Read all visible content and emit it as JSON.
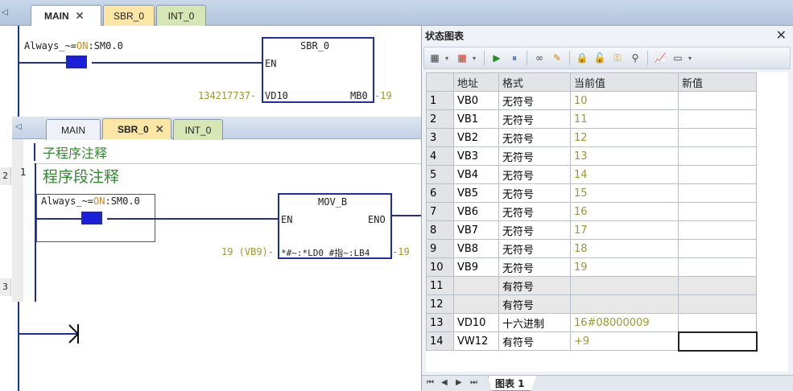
{
  "back_tabs": [
    {
      "label": "MAIN",
      "close": "✕"
    },
    {
      "label": "SBR_0"
    },
    {
      "label": "INT_0"
    }
  ],
  "back_rungs": [
    "2",
    "3"
  ],
  "main_network": {
    "contact_label": "Always_~=",
    "contact_state": "ON",
    "contact_addr": ":SM0.0",
    "block_title": "SBR_0",
    "block_en": "EN",
    "param_in_value": "134217737",
    "param_in": "VD10",
    "param_out": "MB0",
    "param_out_value": "19"
  },
  "front_tabs": [
    {
      "label": "MAIN"
    },
    {
      "label": "SBR_0",
      "close": "✕"
    },
    {
      "label": "INT_0"
    }
  ],
  "sbr": {
    "subroutine_comment": "子程序注释",
    "network_number": "1",
    "network_comment": "程序段注释",
    "contact_label": "Always_~=",
    "contact_state": "ON",
    "contact_addr": ":SM0.0",
    "block_title": "MOV_B",
    "block_en": "EN",
    "block_eno": "ENO",
    "in_value": "19 (VB9)",
    "out_param": "*#~:*LD0 #指~:LB4",
    "out_value": "19"
  },
  "panel": {
    "title": "状态图表",
    "close": "✕",
    "toolbar_icons": [
      "add-row-icon",
      "delete-row-icon",
      "play-icon",
      "pause-icon",
      "glasses-icon",
      "pencil-icon",
      "lock-icon",
      "unlock-icon",
      "force-icon",
      "read-all-icon",
      "trend-chart-icon",
      "label-icon"
    ],
    "columns": [
      "",
      "地址",
      "格式",
      "当前值",
      "新值"
    ],
    "rows": [
      {
        "n": "1",
        "addr": "VB0",
        "fmt": "无符号",
        "val": "10",
        "new": ""
      },
      {
        "n": "2",
        "addr": "VB1",
        "fmt": "无符号",
        "val": "11",
        "new": ""
      },
      {
        "n": "3",
        "addr": "VB2",
        "fmt": "无符号",
        "val": "12",
        "new": ""
      },
      {
        "n": "4",
        "addr": "VB3",
        "fmt": "无符号",
        "val": "13",
        "new": ""
      },
      {
        "n": "5",
        "addr": "VB4",
        "fmt": "无符号",
        "val": "14",
        "new": ""
      },
      {
        "n": "6",
        "addr": "VB5",
        "fmt": "无符号",
        "val": "15",
        "new": ""
      },
      {
        "n": "7",
        "addr": "VB6",
        "fmt": "无符号",
        "val": "16",
        "new": ""
      },
      {
        "n": "8",
        "addr": "VB7",
        "fmt": "无符号",
        "val": "17",
        "new": ""
      },
      {
        "n": "9",
        "addr": "VB8",
        "fmt": "无符号",
        "val": "18",
        "new": ""
      },
      {
        "n": "10",
        "addr": "VB9",
        "fmt": "无符号",
        "val": "19",
        "new": ""
      },
      {
        "n": "11",
        "addr": "",
        "fmt": "有符号",
        "val": "",
        "new": ""
      },
      {
        "n": "12",
        "addr": "",
        "fmt": "有符号",
        "val": "",
        "new": ""
      },
      {
        "n": "13",
        "addr": "VD10",
        "fmt": "十六进制",
        "val": "16#08000009",
        "new": ""
      },
      {
        "n": "14",
        "addr": "VW12",
        "fmt": "有符号",
        "val": "+9",
        "new": ""
      }
    ],
    "sheet_nav": [
      "⏮",
      "◀",
      "▶",
      "⏭"
    ],
    "sheet_tab": "图表 1"
  }
}
